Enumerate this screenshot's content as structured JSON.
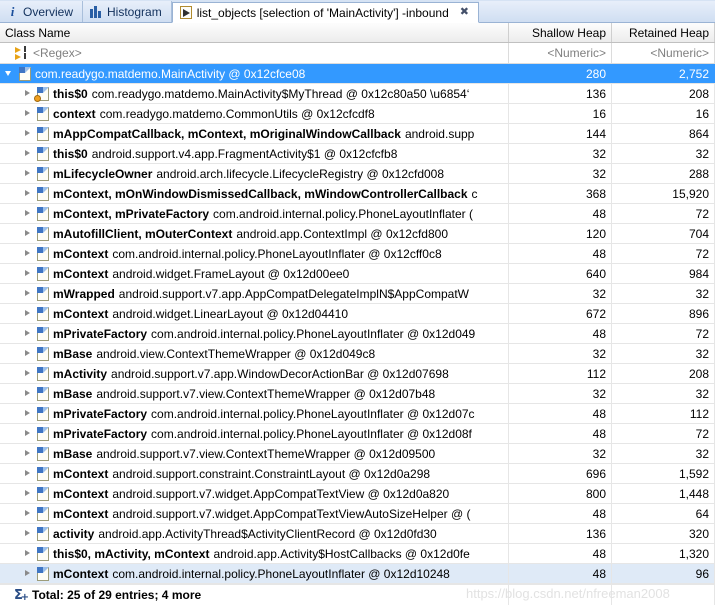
{
  "tabs": [
    {
      "label": "Overview",
      "icon": "info-icon",
      "active": false,
      "closable": false
    },
    {
      "label": "Histogram",
      "icon": "histogram-icon",
      "active": false,
      "closable": false
    },
    {
      "label": "list_objects [selection of 'MainActivity'] -inbound",
      "icon": "list-objects-icon",
      "active": true,
      "closable": true,
      "close_glyph": "✖"
    }
  ],
  "columns": {
    "name": "Class Name",
    "shallow": "Shallow Heap",
    "retained": "Retained Heap"
  },
  "filter_row": {
    "name_placeholder": "<Regex>",
    "shallow_placeholder": "<Numeric>",
    "retained_placeholder": "<Numeric>",
    "icon": "regex-filter-icon"
  },
  "rows": [
    {
      "indent": 0,
      "twisty": "expanded",
      "icon": "object-icon",
      "field": "",
      "type": "com.readygo.matdemo.MainActivity @ 0x12cfce08",
      "shallow": "280",
      "retained": "2,752",
      "selected": true
    },
    {
      "indent": 1,
      "twisty": "collapsed",
      "icon": "thread-object-icon",
      "field": "this$0",
      "type": "com.readygo.matdemo.MainActivity$MyThread @ 0x12c80a50  \\u6854‘",
      "shallow": "136",
      "retained": "208"
    },
    {
      "indent": 1,
      "twisty": "collapsed",
      "icon": "object-icon",
      "field": "context",
      "type": "com.readygo.matdemo.CommonUtils @ 0x12cfcdf8",
      "shallow": "16",
      "retained": "16"
    },
    {
      "indent": 1,
      "twisty": "collapsed",
      "icon": "object-icon",
      "field": "mAppCompatCallback, mContext, mOriginalWindowCallback",
      "type": "android.supp",
      "shallow": "144",
      "retained": "864"
    },
    {
      "indent": 1,
      "twisty": "collapsed",
      "icon": "object-icon",
      "field": "this$0",
      "type": "android.support.v4.app.FragmentActivity$1 @ 0x12cfcfb8",
      "shallow": "32",
      "retained": "32"
    },
    {
      "indent": 1,
      "twisty": "collapsed",
      "icon": "object-icon",
      "field": "mLifecycleOwner",
      "type": "android.arch.lifecycle.LifecycleRegistry @ 0x12cfd008",
      "shallow": "32",
      "retained": "288"
    },
    {
      "indent": 1,
      "twisty": "collapsed",
      "icon": "object-icon",
      "field": "mContext, mOnWindowDismissedCallback, mWindowControllerCallback",
      "type": "c",
      "shallow": "368",
      "retained": "15,920"
    },
    {
      "indent": 1,
      "twisty": "collapsed",
      "icon": "object-icon",
      "field": "mContext, mPrivateFactory",
      "type": "com.android.internal.policy.PhoneLayoutInflater (",
      "shallow": "48",
      "retained": "72"
    },
    {
      "indent": 1,
      "twisty": "collapsed",
      "icon": "object-icon",
      "field": "mAutofillClient, mOuterContext",
      "type": "android.app.ContextImpl @ 0x12cfd800",
      "shallow": "120",
      "retained": "704"
    },
    {
      "indent": 1,
      "twisty": "collapsed",
      "icon": "object-icon",
      "field": "mContext",
      "type": "com.android.internal.policy.PhoneLayoutInflater @ 0x12cff0c8",
      "shallow": "48",
      "retained": "72"
    },
    {
      "indent": 1,
      "twisty": "collapsed",
      "icon": "object-icon",
      "field": "mContext",
      "type": "android.widget.FrameLayout @ 0x12d00ee0",
      "shallow": "640",
      "retained": "984"
    },
    {
      "indent": 1,
      "twisty": "collapsed",
      "icon": "object-icon",
      "field": "mWrapped",
      "type": "android.support.v7.app.AppCompatDelegateImplN$AppCompatW",
      "shallow": "32",
      "retained": "32"
    },
    {
      "indent": 1,
      "twisty": "collapsed",
      "icon": "object-icon",
      "field": "mContext",
      "type": "android.widget.LinearLayout @ 0x12d04410",
      "shallow": "672",
      "retained": "896"
    },
    {
      "indent": 1,
      "twisty": "collapsed",
      "icon": "object-icon",
      "field": "mPrivateFactory",
      "type": "com.android.internal.policy.PhoneLayoutInflater @ 0x12d049",
      "shallow": "48",
      "retained": "72"
    },
    {
      "indent": 1,
      "twisty": "collapsed",
      "icon": "object-icon",
      "field": "mBase",
      "type": "android.view.ContextThemeWrapper @ 0x12d049c8",
      "shallow": "32",
      "retained": "32"
    },
    {
      "indent": 1,
      "twisty": "collapsed",
      "icon": "object-icon",
      "field": "mActivity",
      "type": "android.support.v7.app.WindowDecorActionBar @ 0x12d07698",
      "shallow": "112",
      "retained": "208"
    },
    {
      "indent": 1,
      "twisty": "collapsed",
      "icon": "object-icon",
      "field": "mBase",
      "type": "android.support.v7.view.ContextThemeWrapper @ 0x12d07b48",
      "shallow": "32",
      "retained": "32"
    },
    {
      "indent": 1,
      "twisty": "collapsed",
      "icon": "object-icon",
      "field": "mPrivateFactory",
      "type": "com.android.internal.policy.PhoneLayoutInflater @ 0x12d07c",
      "shallow": "48",
      "retained": "112"
    },
    {
      "indent": 1,
      "twisty": "collapsed",
      "icon": "object-icon",
      "field": "mPrivateFactory",
      "type": "com.android.internal.policy.PhoneLayoutInflater @ 0x12d08f",
      "shallow": "48",
      "retained": "72"
    },
    {
      "indent": 1,
      "twisty": "collapsed",
      "icon": "object-icon",
      "field": "mBase",
      "type": "android.support.v7.view.ContextThemeWrapper @ 0x12d09500",
      "shallow": "32",
      "retained": "32"
    },
    {
      "indent": 1,
      "twisty": "collapsed",
      "icon": "object-icon",
      "field": "mContext",
      "type": "android.support.constraint.ConstraintLayout @ 0x12d0a298",
      "shallow": "696",
      "retained": "1,592"
    },
    {
      "indent": 1,
      "twisty": "collapsed",
      "icon": "object-icon",
      "field": "mContext",
      "type": "android.support.v7.widget.AppCompatTextView @ 0x12d0a820",
      "shallow": "800",
      "retained": "1,448"
    },
    {
      "indent": 1,
      "twisty": "collapsed",
      "icon": "object-icon",
      "field": "mContext",
      "type": "android.support.v7.widget.AppCompatTextViewAutoSizeHelper @ (",
      "shallow": "48",
      "retained": "64"
    },
    {
      "indent": 1,
      "twisty": "collapsed",
      "icon": "object-icon",
      "field": "activity",
      "type": "android.app.ActivityThread$ActivityClientRecord @ 0x12d0fd30",
      "shallow": "136",
      "retained": "320"
    },
    {
      "indent": 1,
      "twisty": "collapsed",
      "icon": "object-icon",
      "field": "this$0, mActivity, mContext",
      "type": "android.app.Activity$HostCallbacks @ 0x12d0fe",
      "shallow": "48",
      "retained": "1,320"
    },
    {
      "indent": 1,
      "twisty": "collapsed",
      "icon": "object-icon",
      "field": "mContext",
      "type": "com.android.internal.policy.PhoneLayoutInflater @ 0x12d10248",
      "shallow": "48",
      "retained": "96",
      "last": true
    }
  ],
  "footer": {
    "icon": "sum-icon",
    "sigma": "Σ",
    "plus": "+",
    "total": "Total: 25 of 29 entries; 4 more"
  },
  "watermark": "https://blog.csdn.net/nfreeman2008",
  "colors": {
    "selection": "#3399ff",
    "tab_bar": "#d6e3f4",
    "accent": "#2a5fa5"
  }
}
